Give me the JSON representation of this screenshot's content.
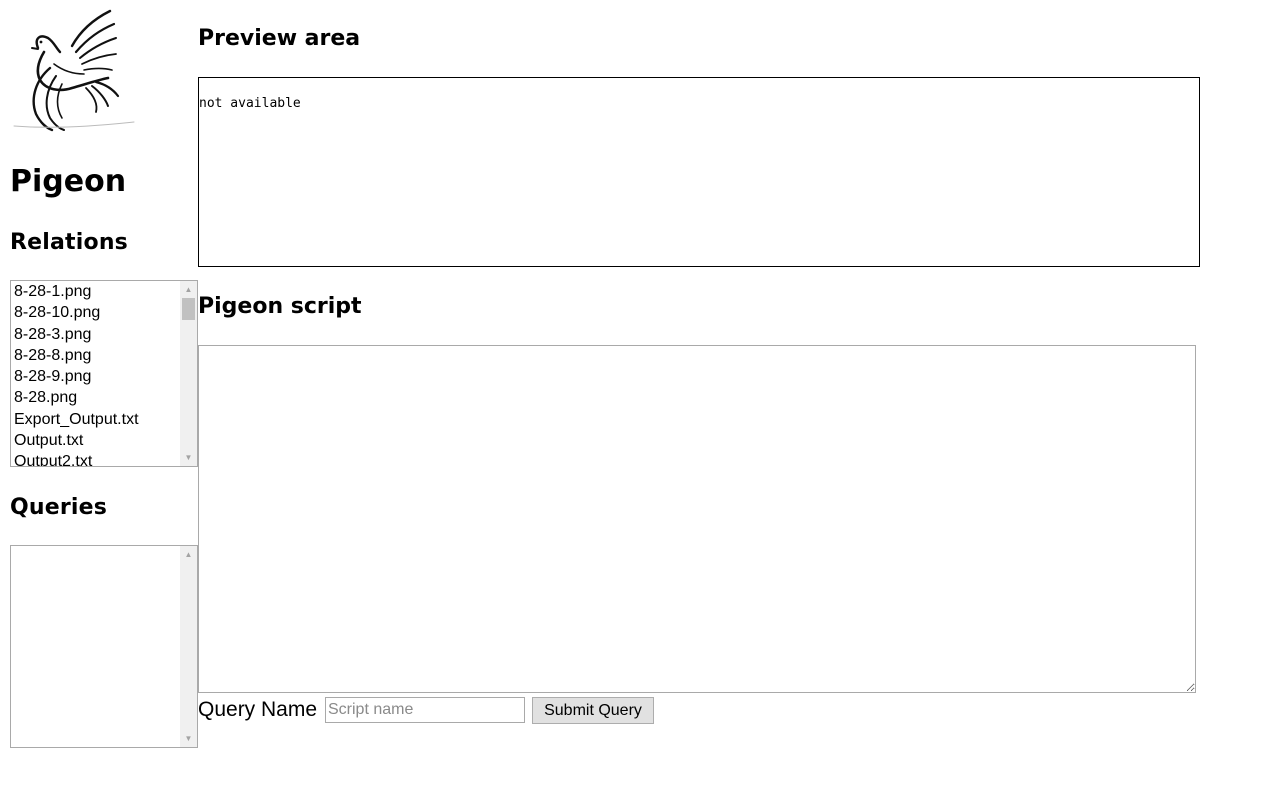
{
  "sidebar": {
    "logo_icon": "pigeon-logo-icon",
    "app_title": "Pigeon",
    "relations_heading": "Relations",
    "relations": [
      "8-28-1.png",
      "8-28-10.png",
      "8-28-3.png",
      "8-28-8.png",
      "8-28-9.png",
      "8-28.png",
      "Export_Output.txt",
      "Output.txt",
      "Output2.txt"
    ],
    "queries_heading": "Queries",
    "queries": []
  },
  "main": {
    "preview_heading": "Preview area",
    "preview_text": "not available",
    "script_heading": "Pigeon script",
    "script_value": "",
    "query_label": "Query Name",
    "query_placeholder": "Script name",
    "query_value": "",
    "submit_label": "Submit Query"
  },
  "colors": {
    "text": "#000000",
    "background": "#ffffff",
    "border": "#a9a9a9",
    "scrollbar": "#f0f0f0",
    "button": "#e1e1e1"
  }
}
